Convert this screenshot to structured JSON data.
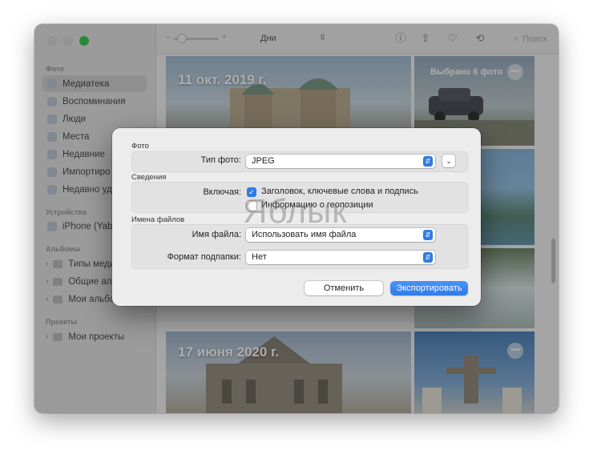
{
  "sidebar": {
    "section_photos": "Фото",
    "items": [
      {
        "label": "Медиатека"
      },
      {
        "label": "Воспоминания"
      },
      {
        "label": "Люди"
      },
      {
        "label": "Места"
      },
      {
        "label": "Недавние"
      },
      {
        "label": "Импортиро"
      },
      {
        "label": "Недавно уд"
      }
    ],
    "section_devices": "Устройства",
    "device": "iPhone (Yab",
    "section_albums": "Альбомы",
    "albums": [
      {
        "label": "Типы медиа"
      },
      {
        "label": "Общие альб"
      },
      {
        "label": "Мои альбом"
      }
    ],
    "section_projects": "Проекты",
    "projects": [
      {
        "label": "Мои проекты"
      }
    ]
  },
  "toolbar": {
    "view_mode": "Дни",
    "search_placeholder": "Поиск"
  },
  "content": {
    "date1": "11 окт. 2019 г.",
    "selected": "Выбрано 6 фото",
    "date2": "17 июня 2020 г.",
    "more": "•••"
  },
  "dialog": {
    "group_photo": "Фото",
    "photo_type_label": "Тип фото:",
    "photo_type_value": "JPEG",
    "group_info": "Сведения",
    "include_label": "Включая:",
    "include_titles": "Заголовок, ключевые слова и подпись",
    "include_titles_checked": true,
    "include_location": "Информацию о геопозиции",
    "include_location_checked": false,
    "group_filenames": "Имена файлов",
    "filename_label": "Имя файла:",
    "filename_value": "Использовать имя файла",
    "subfolder_label": "Формат подпапки:",
    "subfolder_value": "Нет",
    "cancel": "Отменить",
    "export": "Экспортировать"
  },
  "watermark": "Яблык",
  "colors": {
    "accent": "#2f7bea",
    "traffic_green": "#29c73f"
  }
}
